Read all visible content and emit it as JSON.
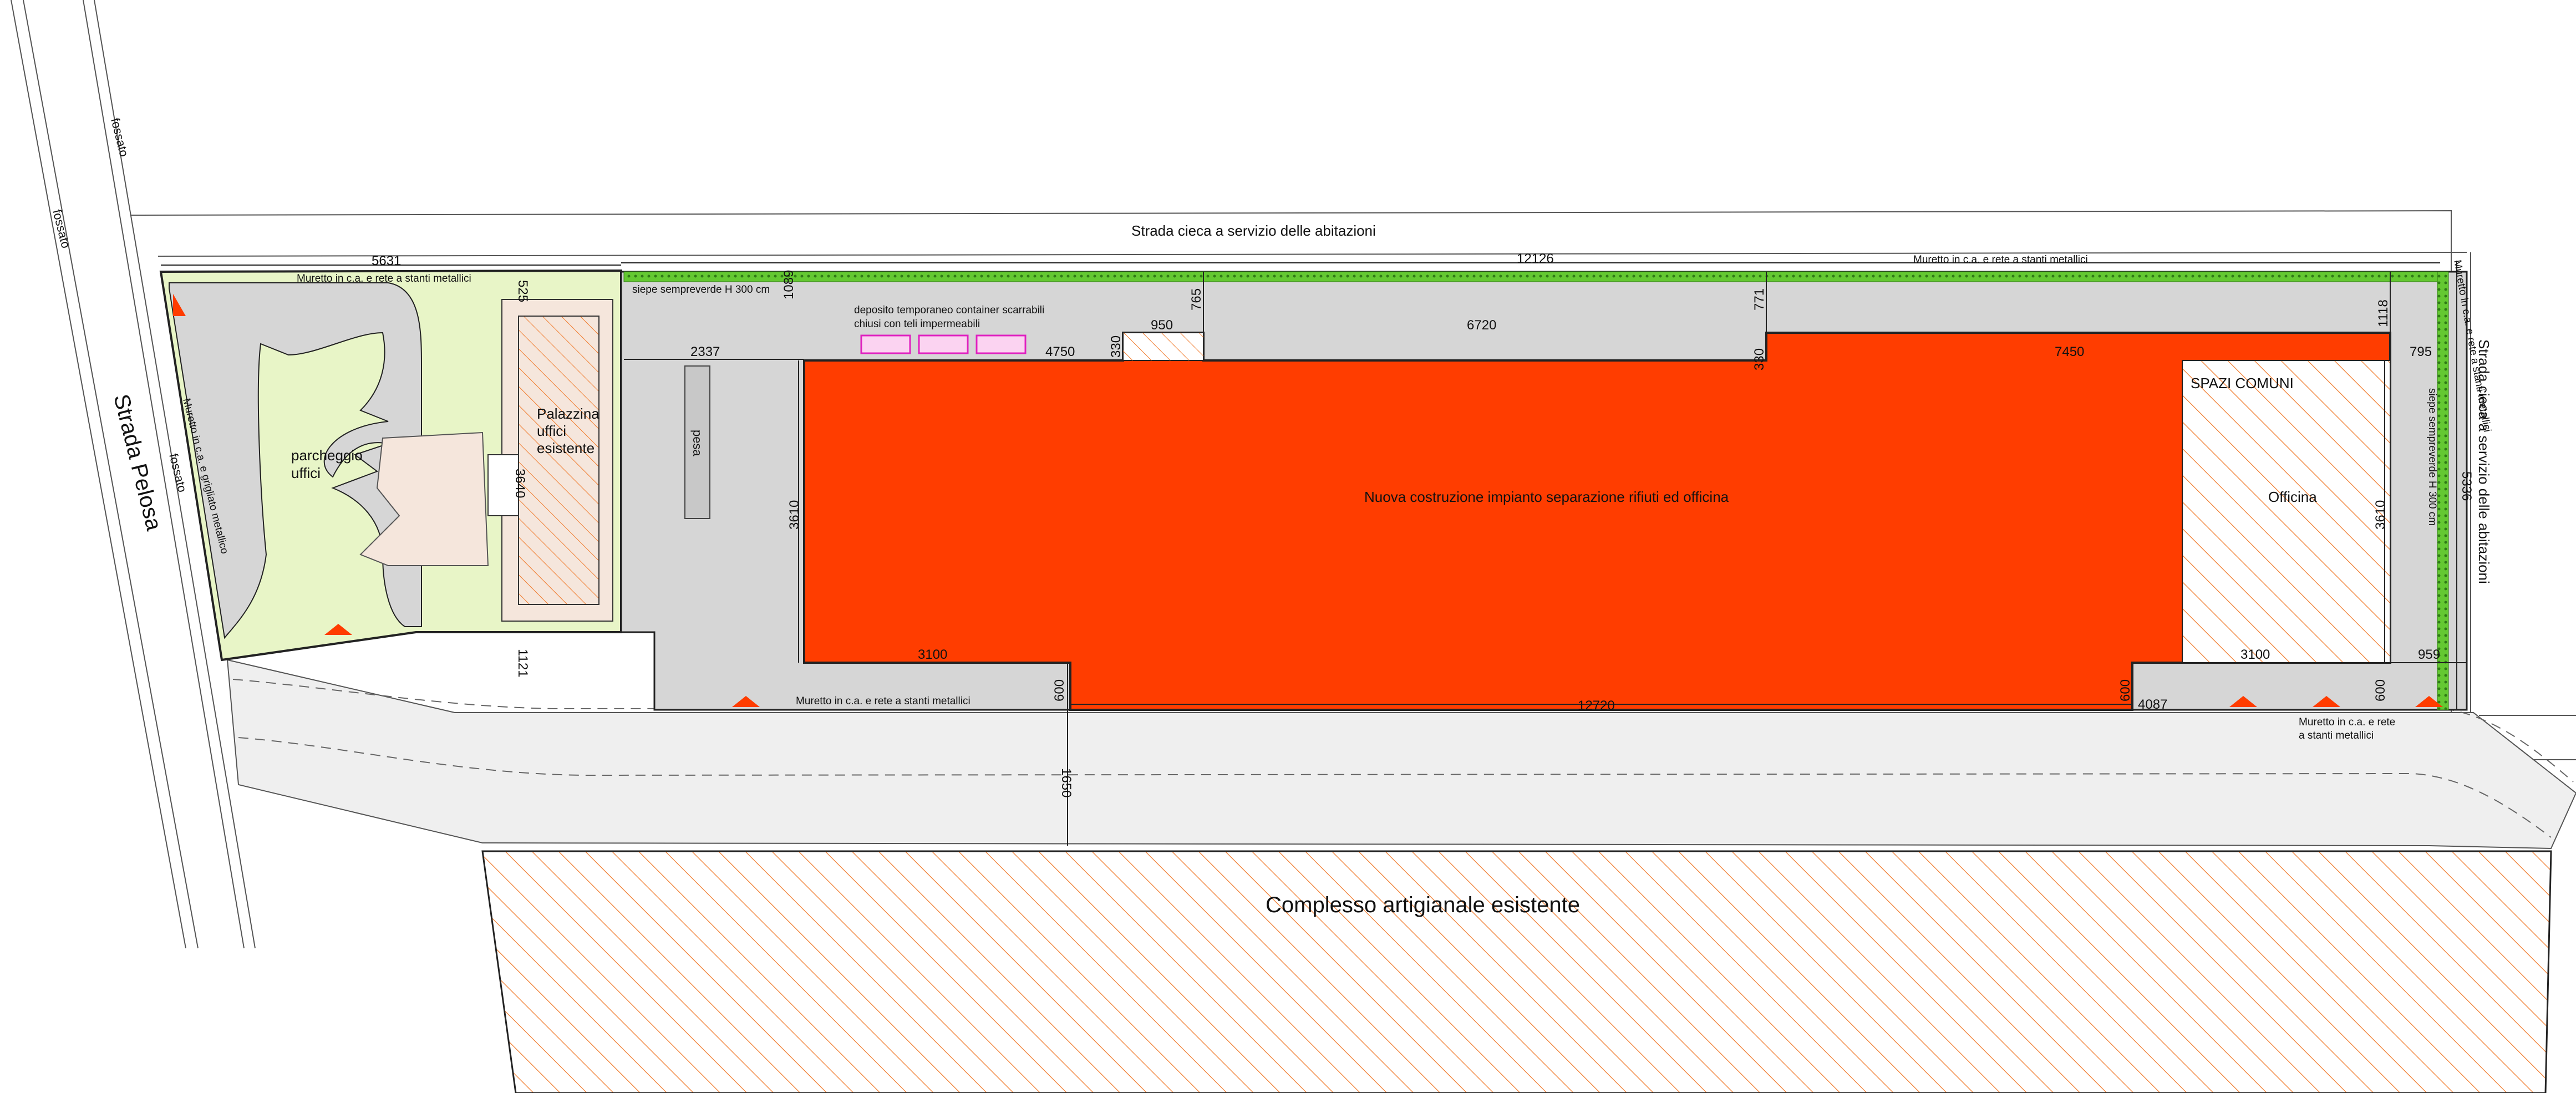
{
  "plan": {
    "labels": {
      "strada_cieca_top": "Strada cieca a servizio delle abitazioni",
      "strada_cieca_right": "Strada cieca a servizio delle abitazioni",
      "strada_pelosa": "Strada Pelosa",
      "fossato_top": "fossato",
      "fossato_mid": "fossato",
      "fossato_lower": "fossato",
      "muretto_top_left": "Muretto in c.a. e rete a stanti metallici",
      "muretto_top_right": "Muretto in c.a. e rete a stanti metallici",
      "muretto_right_vertical": "Muretto in c.a. e rete a stanti metallici",
      "muretto_left_vertical": "Muretto in c.a. e grigliato metallico",
      "muretto_bottom": "Muretto in c.a. e rete a stanti metallici",
      "muretto_bottom_right_1": "Muretto in c.a. e rete",
      "muretto_bottom_right_2": "a stanti metallici",
      "siepe_top": "siepe sempreverde H 300 cm",
      "siepe_right": "siepe sempreverde H 300 cm",
      "deposito_1": "deposito temporaneo container scarrabili",
      "deposito_2": "chiusi con teli impermeabili",
      "parcheggio_1": "parcheggio",
      "parcheggio_2": "uffici",
      "palazzina_1": "Palazzina",
      "palazzina_2": "uffici",
      "palazzina_3": "esistente",
      "pesa": "pesa",
      "nuova_costruzione": "Nuova costruzione impianto separazione rifiuti ed officina",
      "spazi_comuni": "SPAZI COMUNI",
      "officina": "Officina",
      "complesso": "Complesso artigianale esistente"
    },
    "dimensions": {
      "d5631": "5631",
      "d12126": "12126",
      "d525": "525",
      "d1089": "1089",
      "d765": "765",
      "d771": "771",
      "d1118": "1118",
      "d2337": "2337",
      "d4750": "4750",
      "d330a": "330",
      "d950": "950",
      "d6720": "6720",
      "d330b": "330",
      "d7450": "7450",
      "d795": "795",
      "d5336": "5336",
      "d3640": "3640",
      "d3610a": "3610",
      "d3610b": "3610",
      "d1121": "1121",
      "d3100a": "3100",
      "d600a": "600",
      "d12720": "12720",
      "d600b": "600",
      "d4087": "4087",
      "d3100b": "3100",
      "d600c": "600",
      "d959": "959",
      "d1650": "1650"
    },
    "colors": {
      "new_building": "#ff3d00",
      "green_area": "#e8f5c7",
      "paved": "#d6d6d6",
      "hedge": "#64c832",
      "hatch": "#f07828",
      "containers": "#e020c0",
      "entrance_marker": "#ff3c00"
    }
  }
}
